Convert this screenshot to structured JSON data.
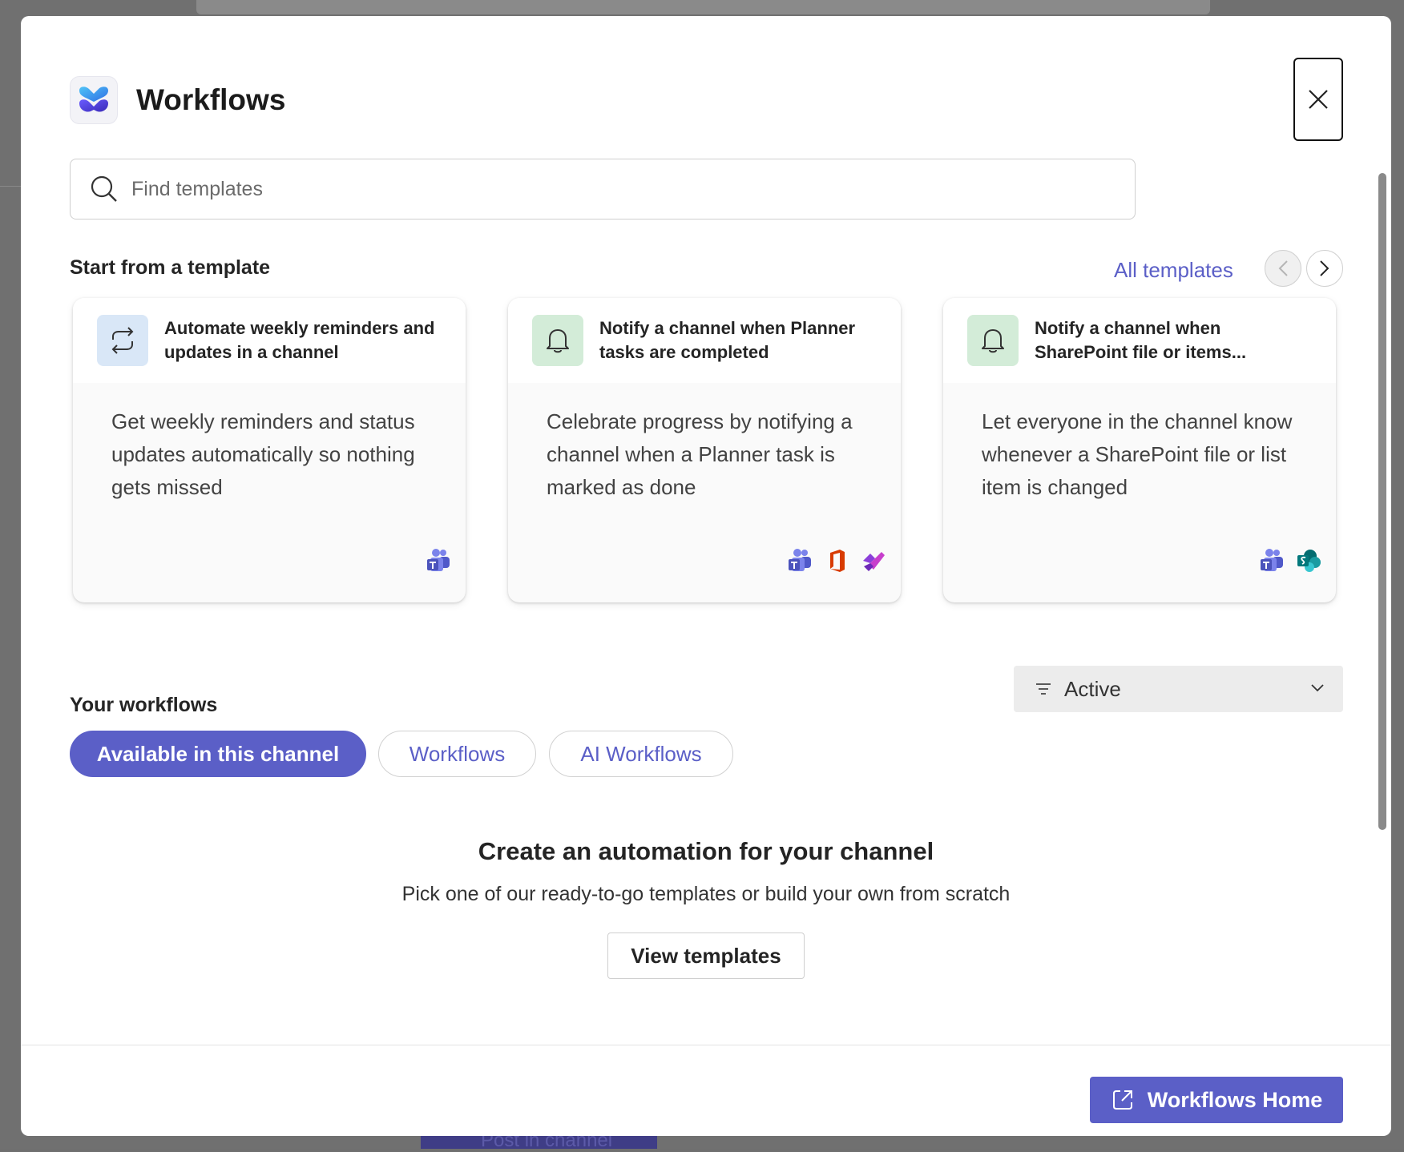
{
  "backdrop": {
    "button_label": "Post in channel"
  },
  "dialog": {
    "title": "Workflows",
    "close_label": "Close"
  },
  "search": {
    "placeholder": "Find templates",
    "value": ""
  },
  "templates": {
    "section_title": "Start from a template",
    "all_link": "All templates",
    "cards": [
      {
        "title": "Automate weekly reminders and updates in a channel",
        "description": "Get weekly reminders and status updates automatically so nothing gets missed",
        "icon": "repeat-icon",
        "apps": [
          "teams-icon"
        ]
      },
      {
        "title": "Notify a channel when Planner tasks are completed",
        "description": "Celebrate progress by notifying a channel when a Planner task is marked as done",
        "icon": "bell-icon",
        "apps": [
          "teams-icon",
          "office-icon",
          "planner-icon"
        ]
      },
      {
        "title": "Notify a channel when SharePoint file or items...",
        "description": "Let everyone in the channel know whenever a SharePoint file or list item is changed",
        "icon": "bell-icon",
        "apps": [
          "teams-icon",
          "sharepoint-icon"
        ]
      }
    ]
  },
  "your_workflows": {
    "section_title": "Your workflows",
    "filter_value": "Active",
    "tabs": [
      {
        "label": "Available in this channel",
        "active": true
      },
      {
        "label": "Workflows",
        "active": false
      },
      {
        "label": "AI Workflows",
        "active": false
      }
    ],
    "empty_title": "Create an automation for your channel",
    "empty_subtitle": "Pick one of our ready-to-go templates or build your own from scratch",
    "view_button": "View templates"
  },
  "footer": {
    "home_button": "Workflows Home"
  },
  "colors": {
    "accent": "#5b5fc7",
    "blue_icon_bg": "#d9e7f7",
    "green_icon_bg": "#d3ecd8"
  }
}
